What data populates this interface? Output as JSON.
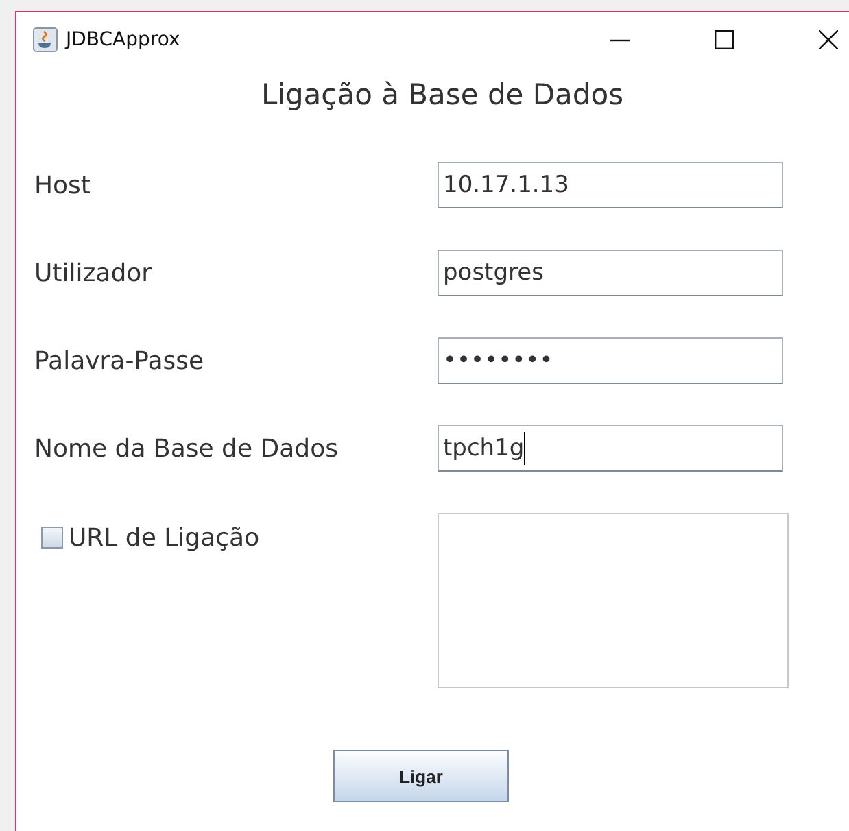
{
  "window": {
    "title": "JDBCApprox"
  },
  "heading": "Ligação à Base de Dados",
  "fields": [
    {
      "label": "Host",
      "value": "10.17.1.13",
      "focused": false
    },
    {
      "label": "Utilizador",
      "value": "postgres",
      "focused": false
    },
    {
      "label": "Palavra-Passe",
      "value": "••••••••",
      "focused": false
    },
    {
      "label": "Nome da Base de Dados",
      "value": "tpch1g",
      "focused": true
    }
  ],
  "url_option": {
    "label": "URL de Ligação",
    "checked": false,
    "text_area_disabled": true
  },
  "buttons": [
    "Ligar"
  ]
}
